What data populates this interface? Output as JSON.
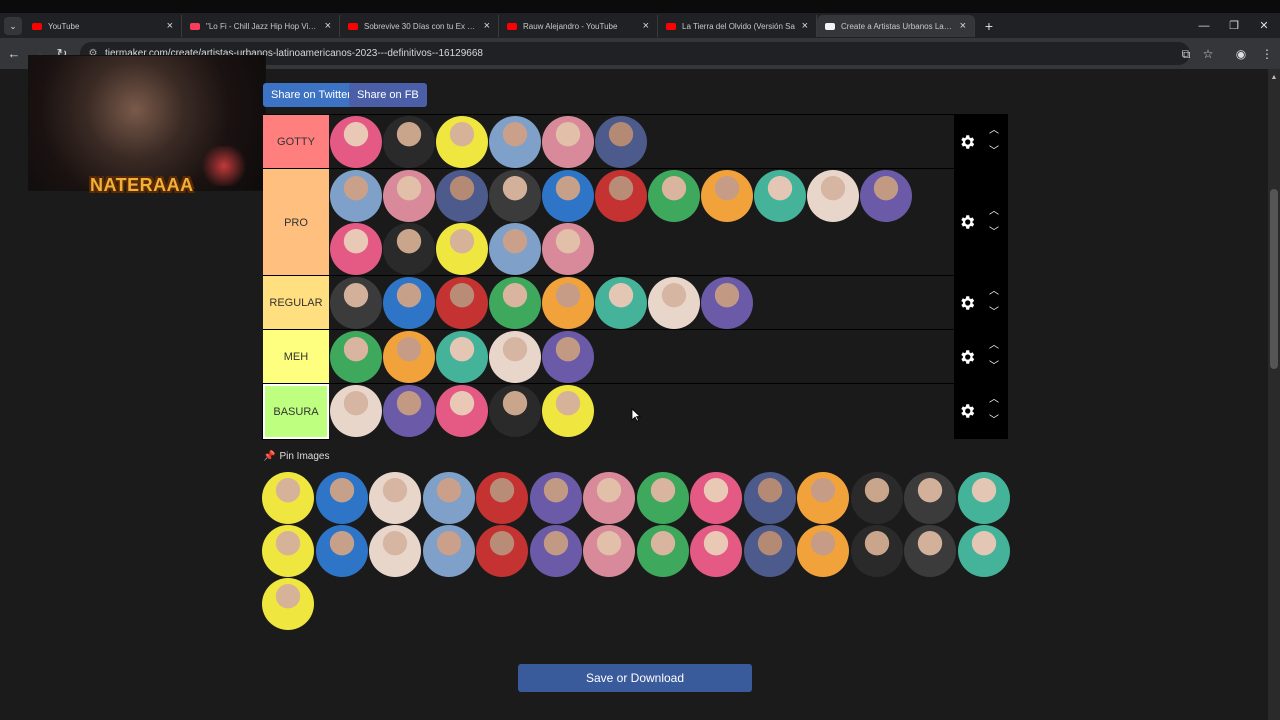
{
  "browser": {
    "tabs": [
      {
        "label": "YouTube",
        "favicon": "youtube-icon",
        "color": "#ff0000"
      },
      {
        "label": "\"Lo Fi - Chill Jazz Hip Hop Vibes",
        "favicon": "music-icon",
        "color": "#ff3b5c"
      },
      {
        "label": "Sobrevive 30 Días con tu Ex en M",
        "favicon": "youtube-icon",
        "color": "#ff0000"
      },
      {
        "label": "Rauw Alejandro - YouTube",
        "favicon": "youtube-icon",
        "color": "#ff0000"
      },
      {
        "label": "La Tierra del Olvido (Versión Sa",
        "favicon": "youtube-icon",
        "color": "#ff0000"
      },
      {
        "label": "Create a Artistas Urbanos Latinoa",
        "favicon": "tiermaker-icon",
        "color": "#f4f4f4"
      }
    ],
    "new_tab": "+",
    "url": "tiermaker.com/create/artistas-urbanos-latinoamericanos-2023---definitivos--16129668"
  },
  "streamer": {
    "name": "NATERAAA"
  },
  "share": {
    "twitter_label": "Share on Twitter",
    "fb_label": "Share on FB"
  },
  "tiers": [
    {
      "label": "GOTTY",
      "color": "#ff7f7f",
      "items": 6
    },
    {
      "label": "PRO",
      "color": "#ffbf7f",
      "items": 16
    },
    {
      "label": "REGULAR",
      "color": "#ffdf7f",
      "items": 8
    },
    {
      "label": "MEH",
      "color": "#ffff7f",
      "items": 5
    },
    {
      "label": "BASURA",
      "color": "#bfff7f",
      "items": 5
    }
  ],
  "pin": {
    "label": "Pin Images",
    "pool_count": 29
  },
  "save": {
    "label": "Save or Download"
  }
}
